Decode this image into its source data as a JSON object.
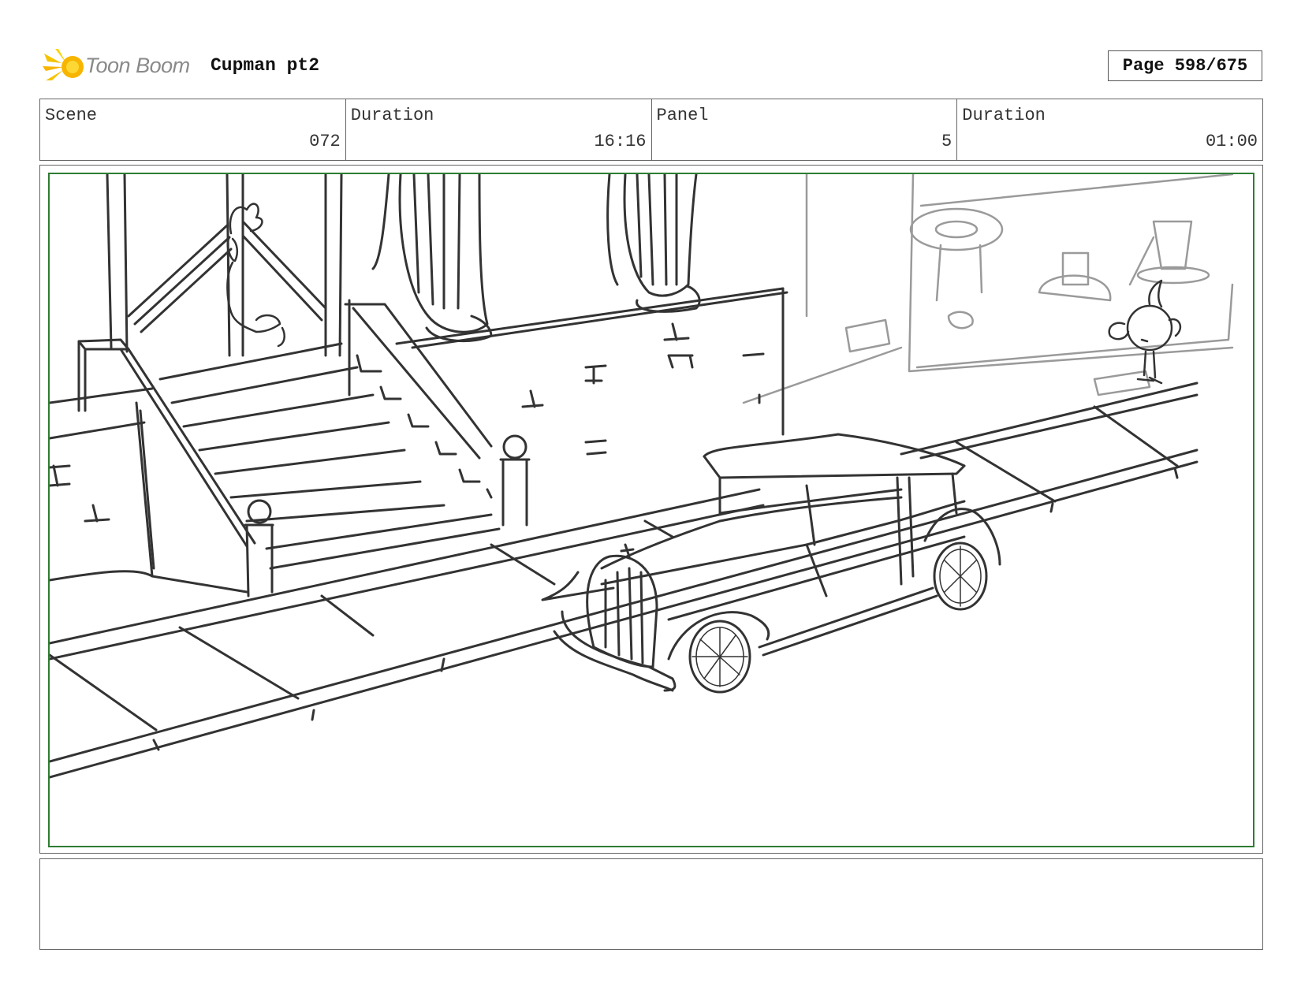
{
  "header": {
    "logo_text": "Toon Boom",
    "project_title": "Cupman pt2",
    "page_label": "Page 598/675"
  },
  "info": {
    "scene_label": "Scene",
    "scene_value": "072",
    "scene_duration_label": "Duration",
    "scene_duration_value": "16:16",
    "panel_label": "Panel",
    "panel_value": "5",
    "panel_duration_label": "Duration",
    "panel_duration_value": "01:00"
  },
  "colors": {
    "safe_frame": "#2e7d32",
    "logo_accent": "#f5c400",
    "sketch_line": "#333333",
    "sketch_faint": "#9a9a9a"
  },
  "panel": {
    "sketch_icon": "storyboard-sketch",
    "notes": ""
  }
}
